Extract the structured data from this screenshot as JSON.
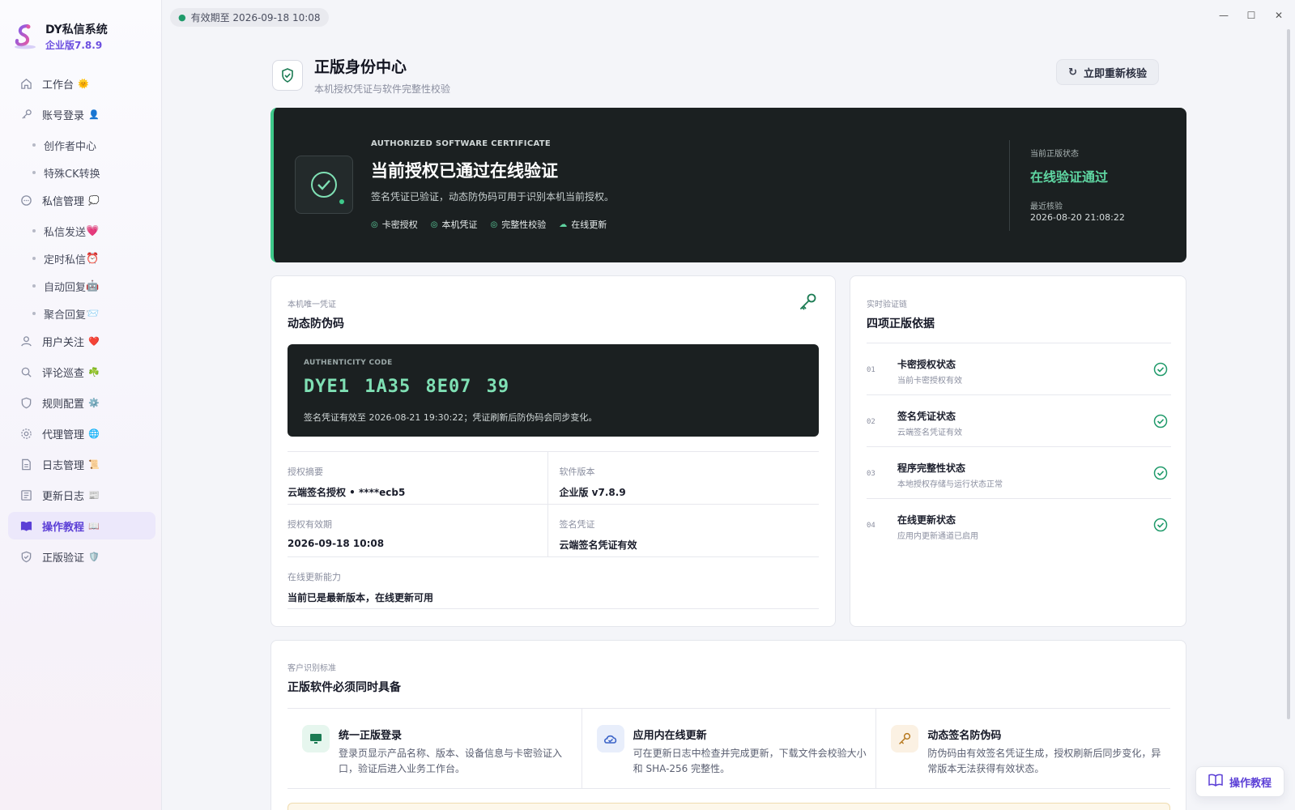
{
  "brand": {
    "name": "DY私信系统",
    "version": "企业版7.8.9"
  },
  "nav": [
    {
      "label": "工作台",
      "emoji": "🌞",
      "icon": "home-icon",
      "type": "item"
    },
    {
      "label": "账号登录",
      "emoji": "👤",
      "icon": "key-icon",
      "type": "item"
    },
    {
      "label": "创作者中心",
      "type": "sub"
    },
    {
      "label": "特殊CK转换",
      "type": "sub"
    },
    {
      "label": "私信管理",
      "emoji": "💭",
      "icon": "chat-icon",
      "type": "item"
    },
    {
      "label": "私信发送",
      "emoji": "💗",
      "type": "sub"
    },
    {
      "label": "定时私信",
      "emoji": "⏰",
      "type": "sub"
    },
    {
      "label": "自动回复",
      "emoji": "🤖",
      "type": "sub"
    },
    {
      "label": "聚合回复",
      "emoji": "📨",
      "type": "sub"
    },
    {
      "label": "用户关注",
      "emoji": "❤️",
      "icon": "user-icon",
      "type": "item"
    },
    {
      "label": "评论巡查",
      "emoji": "☘️",
      "icon": "search-icon",
      "type": "item"
    },
    {
      "label": "规则配置",
      "emoji": "⚙️",
      "icon": "shield-icon",
      "type": "item"
    },
    {
      "label": "代理管理",
      "emoji": "🌐",
      "icon": "gear-icon",
      "type": "item"
    },
    {
      "label": "日志管理",
      "emoji": "📜",
      "icon": "document-icon",
      "type": "item"
    },
    {
      "label": "更新日志",
      "emoji": "📰",
      "icon": "newspaper-icon",
      "type": "item"
    },
    {
      "label": "操作教程",
      "emoji": "📖",
      "icon": "book-icon",
      "type": "item",
      "active": true
    },
    {
      "label": "正版验证",
      "emoji": "🛡️",
      "icon": "shield-check-icon",
      "type": "item"
    }
  ],
  "topbar": {
    "expiry": "有效期至 2026-09-18 10:08"
  },
  "header": {
    "title": "正版身份中心",
    "subtitle": "本机授权凭证与软件完整性校验",
    "recheck_label": "立即重新核验"
  },
  "hero": {
    "eyebrow": "AUTHORIZED SOFTWARE CERTIFICATE",
    "title": "当前授权已通过在线验证",
    "desc": "签名凭证已验证，动态防伪码可用于识别本机当前授权。",
    "tags": [
      "卡密授权",
      "本机凭证",
      "完整性校验",
      "在线更新"
    ],
    "status_label": "当前正版状态",
    "status": "在线验证通过",
    "last_label": "最近核验",
    "last_time": "2026-08-20 21:08:22",
    "accent": "#3ec98a"
  },
  "code_card": {
    "eyebrow": "本机唯一凭证",
    "title": "动态防伪码",
    "code_label": "AUTHENTICITY CODE",
    "code": "DYE1 1A35 8E07 39",
    "code_note": "签名凭证有效至 2026-08-21 19:30:22；凭证刷新后防伪码会同步变化。",
    "info": [
      {
        "label": "授权摘要",
        "value": "云端签名授权 • ****ecb5"
      },
      {
        "label": "软件版本",
        "value": "企业版 v7.8.9"
      },
      {
        "label": "授权有效期",
        "value": "2026-09-18 10:08"
      },
      {
        "label": "签名凭证",
        "value": "云端签名凭证有效"
      },
      {
        "label": "在线更新能力",
        "value": "当前已是最新版本，在线更新可用"
      }
    ]
  },
  "chain_card": {
    "eyebrow": "实时验证链",
    "title": "四项正版依据",
    "items": [
      {
        "num": "01",
        "title": "卡密授权状态",
        "desc": "当前卡密授权有效"
      },
      {
        "num": "02",
        "title": "签名凭证状态",
        "desc": "云端签名凭证有效"
      },
      {
        "num": "03",
        "title": "程序完整性状态",
        "desc": "本地授权存储与运行状态正常"
      },
      {
        "num": "04",
        "title": "在线更新状态",
        "desc": "应用内更新通道已启用"
      }
    ]
  },
  "std_card": {
    "eyebrow": "客户识别标准",
    "title": "正版软件必须同时具备",
    "items": [
      {
        "title": "统一正版登录",
        "desc": "登录页显示产品名称、版本、设备信息与卡密验证入口，验证后进入业务工作台。",
        "icon": "monitor-icon"
      },
      {
        "title": "应用内在线更新",
        "desc": "可在更新日志中检查并完成更新，下载文件会校验大小和 SHA-256 完整性。",
        "icon": "cloud-icon"
      },
      {
        "title": "动态签名防伪码",
        "desc": "防伪码由有效签名凭证生成，授权刷新后同步变化，异常版本无法获得有效状态。",
        "icon": "key-icon"
      }
    ]
  },
  "float_help": {
    "label": "操作教程"
  }
}
